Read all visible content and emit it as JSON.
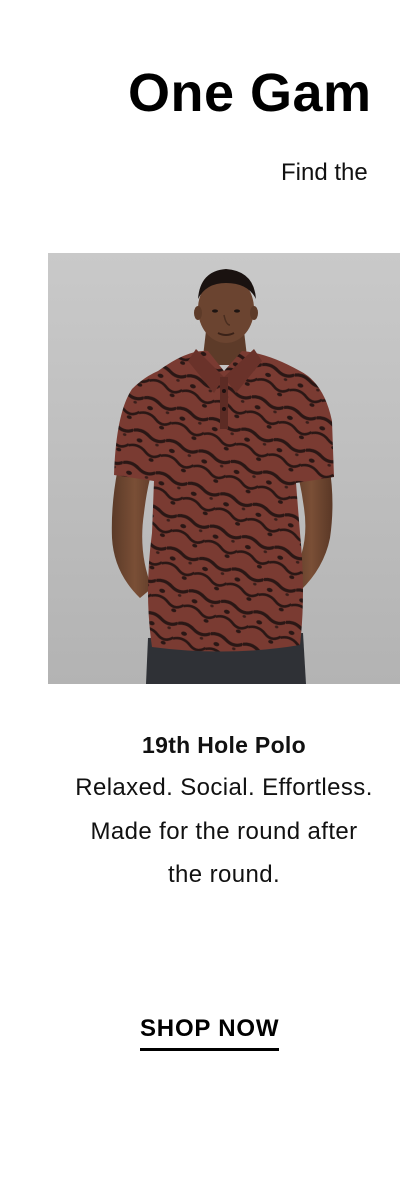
{
  "header": {
    "headline": "One Gam",
    "subhead": "Find the"
  },
  "product": {
    "image_subject": "man-in-animal-print-polo",
    "name": "19th Hole Polo",
    "description": "Relaxed. Social. Effortless. Made for the round after the round.",
    "cta_label": "SHOP NOW"
  },
  "colors": {
    "text": "#111111",
    "background": "#ffffff",
    "photo_background": "#c4c4c4",
    "shirt_base": "#7a3b32",
    "shirt_pattern": "#2a1715"
  }
}
